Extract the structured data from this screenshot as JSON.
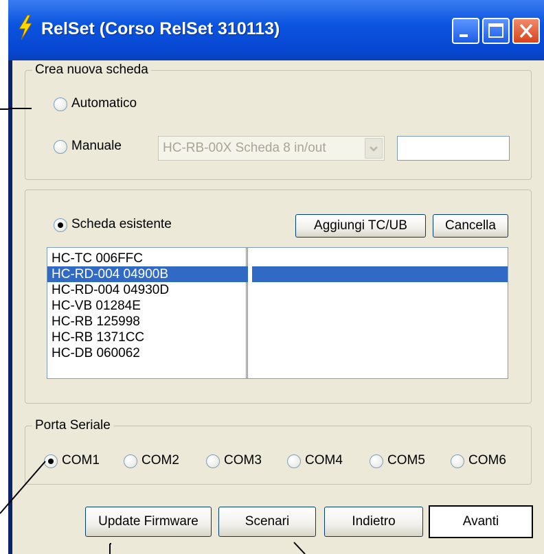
{
  "window": {
    "title": "RelSet (Corso RelSet 310113)"
  },
  "title_buttons": {
    "minimize": "minimize-icon",
    "maximize": "maximize-icon",
    "close": "close-icon"
  },
  "nuova_scheda": {
    "legend": "Crea nuova scheda",
    "automatico_label": "Automatico",
    "manuale_label": "Manuale",
    "combo_value": "HC-RB-00X Scheda 8 in/out",
    "text_value": ""
  },
  "esistente": {
    "radio_label": "Scheda esistente",
    "add_button": "Aggiungi TC/UB",
    "cancel_button": "Cancella",
    "items": [
      "HC-TC 006FFC",
      "HC-RD-004 04900B",
      "HC-RD-004 04930D",
      "HC-VB 01284E",
      "HC-RB 125998",
      "HC-RB 1371CC",
      "HC-DB 060062"
    ],
    "selected_index": 1
  },
  "porta": {
    "legend": "Porta Seriale",
    "ports": [
      "COM1",
      "COM2",
      "COM3",
      "COM4",
      "COM5",
      "COM6"
    ],
    "selected": "COM1"
  },
  "buttons": {
    "update_firmware": "Update Firmware",
    "scenari": "Scenari",
    "indietro": "Indietro",
    "avanti": "Avanti"
  },
  "colors": {
    "titlebar": "#0a54e0",
    "selection": "#316ac5",
    "dialog": "#ece9d8"
  }
}
